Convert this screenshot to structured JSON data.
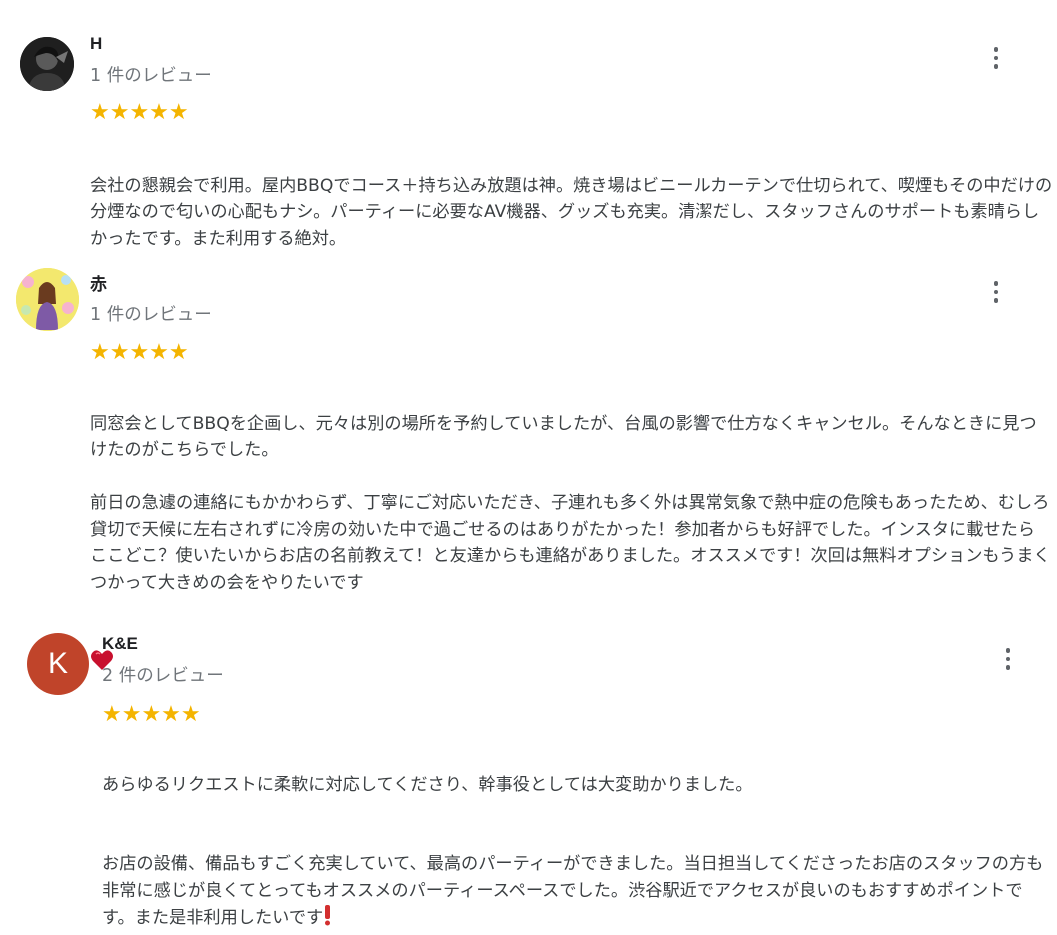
{
  "reviews": [
    {
      "name": "H",
      "count": "1 件のレビュー",
      "stars": "★★★★★",
      "rating": 5,
      "text": "会社の懇親会で利用。屋内BBQでコース＋持ち込み放題は神。焼き場はビニールカーテンで仕切られて、喫煙もその中だけの分煙なので匂いの心配もナシ。パーティーに必要なAV機器、グッズも充実。清潔だし、スタッフさんのサポートも素晴らしかったです。また利用する絶対。"
    },
    {
      "name": "赤",
      "count": "1 件のレビュー",
      "stars": "★★★★★",
      "rating": 5,
      "text_p1": "同窓会としてBBQを企画し、元々は別の場所を予約していましたが、台風の影響で仕方なくキャンセル。そんなときに見つけたのがこちらでした。",
      "text_p2": "前日の急遽の連絡にもかかわらず、丁寧にご対応いただき、子連れも多く外は異常気象で熱中症の危険もあったため、むしろ貸切で天候に左右されずに冷房の効いた中で過ごせるのはありがたかった！参加者からも好評でした。インスタに載せたらここどこ？使いたいからお店の名前教えて！と友達からも連絡がありました。オススメです！次回は無料オプションもうまくつかって大きめの会をやりたいです",
      "emoji": "heart"
    },
    {
      "name": "K&E",
      "initial": "K",
      "avatar_color": "#c0442a",
      "count": "2 件のレビュー",
      "stars": "★★★★★",
      "rating": 5,
      "text_p1": "あらゆるリクエストに柔軟に対応してくださり、幹事役としては大変助かりました。",
      "text_p2": "お店の設備、備品もすごく充実していて、最高のパーティーができました。当日担当してくださったお店のスタッフの方も非常に感じが良くてとってもオススメのパーティースペースでした。渋谷駅近でアクセスが良いのもおすすめポイントです。また是非利用したいです",
      "emoji": "exclamation"
    }
  ]
}
